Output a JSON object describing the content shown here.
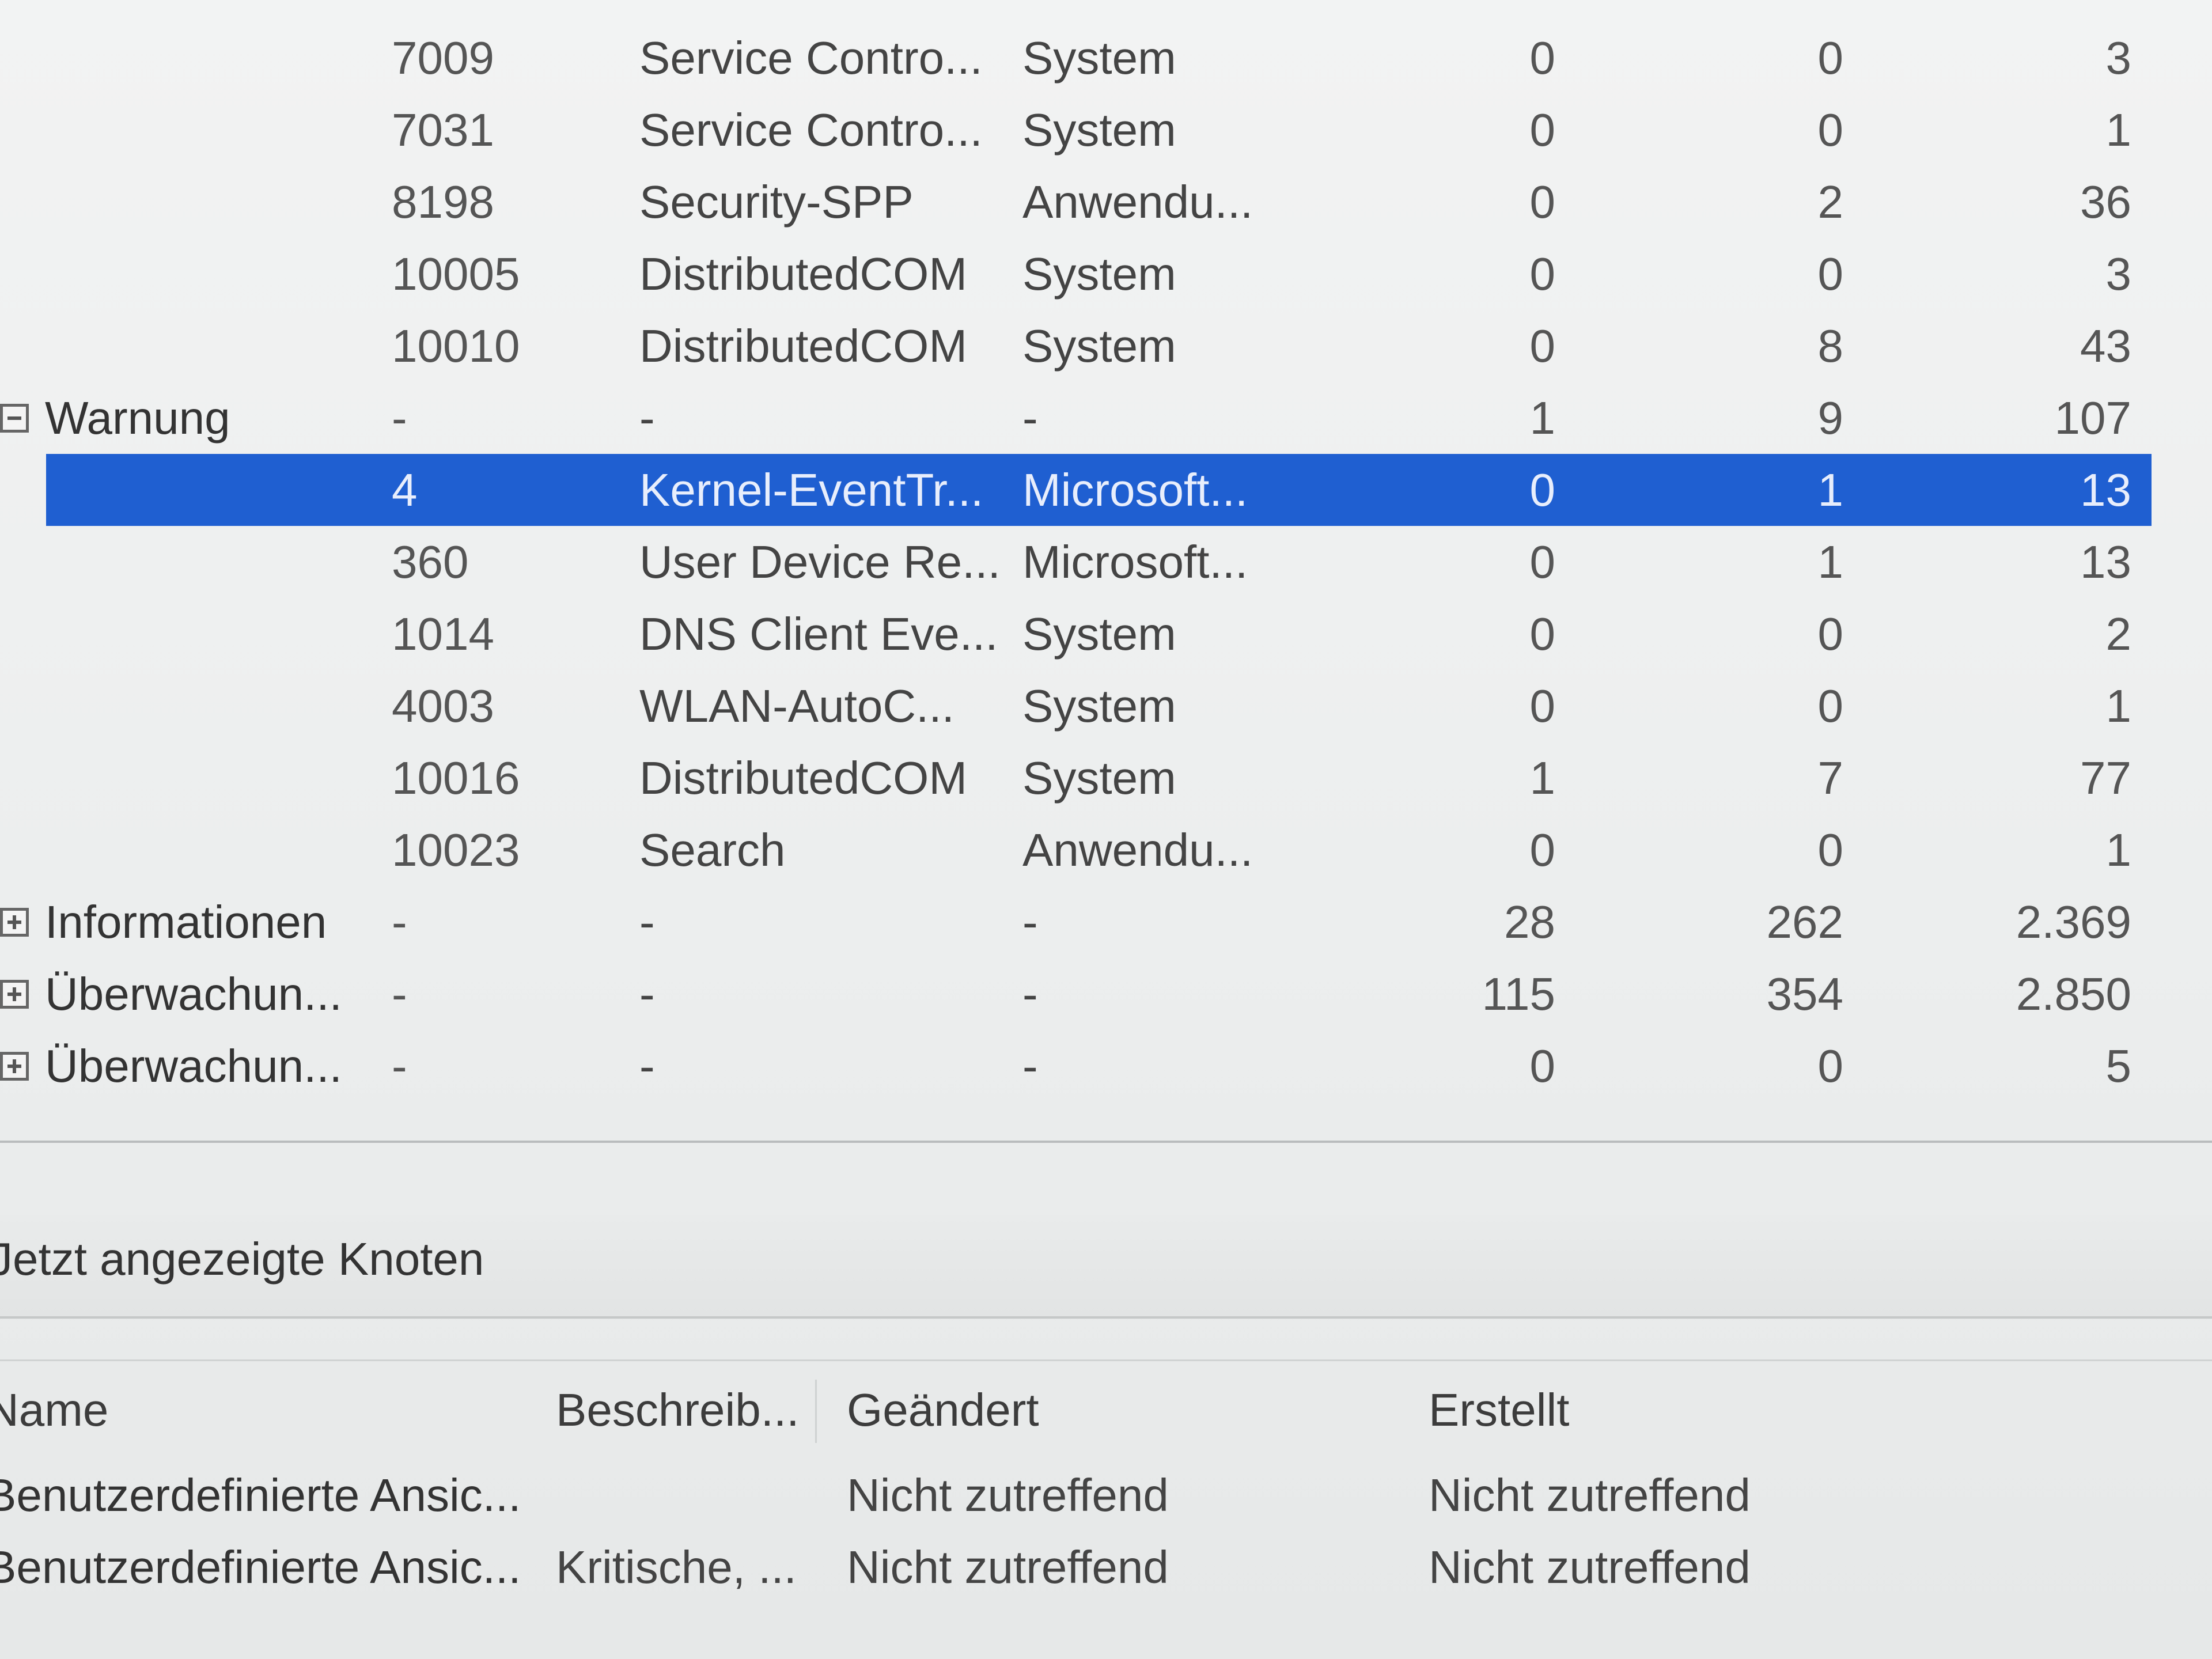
{
  "event_summary": {
    "rows": [
      {
        "label": "",
        "id": "7009",
        "source": "Service Contro...",
        "log": "System",
        "n1": "0",
        "n2": "0",
        "n3": "3"
      },
      {
        "label": "",
        "id": "7031",
        "source": "Service Contro...",
        "log": "System",
        "n1": "0",
        "n2": "0",
        "n3": "1"
      },
      {
        "label": "",
        "id": "8198",
        "source": "Security-SPP",
        "log": "Anwendu...",
        "n1": "0",
        "n2": "2",
        "n3": "36"
      },
      {
        "label": "",
        "id": "10005",
        "source": "DistributedCOM",
        "log": "System",
        "n1": "0",
        "n2": "0",
        "n3": "3"
      },
      {
        "label": "",
        "id": "10010",
        "source": "DistributedCOM",
        "log": "System",
        "n1": "0",
        "n2": "8",
        "n3": "43"
      },
      {
        "label": "Warnung",
        "id": "-",
        "source": "-",
        "log": "-",
        "n1": "1",
        "n2": "9",
        "n3": "107",
        "expander": "collapse"
      },
      {
        "label": "",
        "id": "4",
        "source": "Kernel-EventTr...",
        "log": "Microsoft...",
        "n1": "0",
        "n2": "1",
        "n3": "13",
        "selected": true
      },
      {
        "label": "",
        "id": "360",
        "source": "User Device Re...",
        "log": "Microsoft...",
        "n1": "0",
        "n2": "1",
        "n3": "13"
      },
      {
        "label": "",
        "id": "1014",
        "source": "DNS Client Eve...",
        "log": "System",
        "n1": "0",
        "n2": "0",
        "n3": "2"
      },
      {
        "label": "",
        "id": "4003",
        "source": "WLAN-AutoC...",
        "log": "System",
        "n1": "0",
        "n2": "0",
        "n3": "1"
      },
      {
        "label": "",
        "id": "10016",
        "source": "DistributedCOM",
        "log": "System",
        "n1": "1",
        "n2": "7",
        "n3": "77"
      },
      {
        "label": "",
        "id": "10023",
        "source": "Search",
        "log": "Anwendu...",
        "n1": "0",
        "n2": "0",
        "n3": "1"
      },
      {
        "label": "Informationen",
        "id": "-",
        "source": "-",
        "log": "-",
        "n1": "28",
        "n2": "262",
        "n3": "2.369",
        "expander": "expand"
      },
      {
        "label": "Überwachun...",
        "id": "-",
        "source": "-",
        "log": "-",
        "n1": "115",
        "n2": "354",
        "n3": "2.850",
        "expander": "expand"
      },
      {
        "label": "Überwachun...",
        "id": "-",
        "source": "-",
        "log": "-",
        "n1": "0",
        "n2": "0",
        "n3": "5",
        "expander": "expand"
      }
    ]
  },
  "recent_nodes": {
    "title": "Jetzt angezeigte Knoten",
    "columns": {
      "name": "Name",
      "description": "Beschreib...",
      "modified": "Geändert",
      "created": "Erstellt"
    },
    "rows": [
      {
        "name": "Benutzerdefinierte Ansic...",
        "description": "",
        "modified": "Nicht zutreffend",
        "created": "Nicht zutreffend"
      },
      {
        "name": "Benutzerdefinierte Ansic...",
        "description": "Kritische, ...",
        "modified": "Nicht zutreffend",
        "created": "Nicht zutreffend"
      }
    ]
  },
  "colors": {
    "selection": "#1f5fd1",
    "background": "#eef0f0"
  }
}
